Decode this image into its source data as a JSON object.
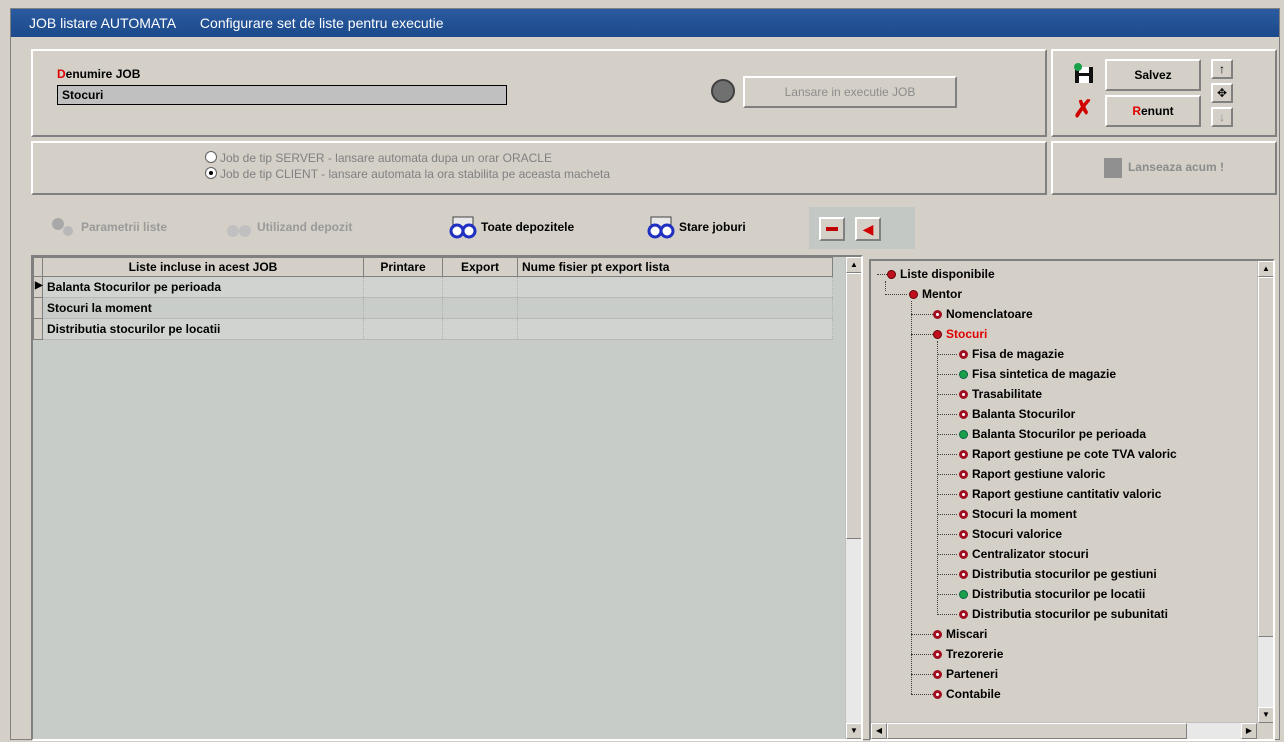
{
  "window": {
    "title_left": "JOB listare AUTOMATA",
    "title_right": "Configurare set de liste pentru executie"
  },
  "job": {
    "name_label": "Denumire JOB",
    "name_value": "Stocuri",
    "launch_button": "Lansare in executie JOB"
  },
  "actions": {
    "save": "Salvez",
    "cancel": "Renunt",
    "launch_now": "Lanseaza acum !"
  },
  "job_type": {
    "server_label": "Job de tip SERVER  - lansare automata dupa un orar ORACLE",
    "client_label": "Job de tip CLIENT   - lansare automata la ora stabilita pe aceasta macheta",
    "selected": "client"
  },
  "toolbar": {
    "params": "Parametrii liste",
    "deposit": "Utilizand depozit",
    "all_deposits": "Toate depozitele",
    "job_state": "Stare joburi"
  },
  "grid": {
    "headers": [
      "Liste incluse in acest JOB",
      "Printare",
      "Export",
      "Nume fisier pt export lista"
    ],
    "rows": [
      {
        "name": "Balanta Stocurilor pe perioada",
        "printare": "",
        "export": "",
        "file": ""
      },
      {
        "name": "Stocuri la moment",
        "printare": "",
        "export": "",
        "file": ""
      },
      {
        "name": "Distributia stocurilor pe locatii",
        "printare": "",
        "export": "",
        "file": ""
      }
    ]
  },
  "tree": {
    "root": "Liste disponibile",
    "mentor": "Mentor",
    "nomenclatoare": "Nomenclatoare",
    "stocuri": "Stocuri",
    "stocuri_children": [
      {
        "label": "Fisa de magazie",
        "state": "ring"
      },
      {
        "label": "Fisa sintetica de magazie",
        "state": "green"
      },
      {
        "label": "Trasabilitate",
        "state": "ring"
      },
      {
        "label": "Balanta Stocurilor",
        "state": "ring"
      },
      {
        "label": "Balanta Stocurilor pe perioada",
        "state": "green"
      },
      {
        "label": "Raport gestiune pe cote TVA valoric",
        "state": "ring"
      },
      {
        "label": "Raport gestiune valoric",
        "state": "ring"
      },
      {
        "label": "Raport gestiune cantitativ valoric",
        "state": "ring"
      },
      {
        "label": "Stocuri  la moment",
        "state": "ring"
      },
      {
        "label": "Stocuri valorice",
        "state": "ring"
      },
      {
        "label": "Centralizator stocuri",
        "state": "ring"
      },
      {
        "label": "Distributia stocurilor pe gestiuni",
        "state": "ring"
      },
      {
        "label": "Distributia stocurilor pe locatii",
        "state": "green"
      },
      {
        "label": "Distributia stocurilor pe subunitati",
        "state": "ring"
      }
    ],
    "others": [
      "Miscari",
      "Trezorerie",
      "Parteneri",
      "Contabile"
    ]
  },
  "colors": {
    "title_bar": "#1c4a8a",
    "accent_red": "#e00000",
    "status_green": "#1aa04a"
  }
}
